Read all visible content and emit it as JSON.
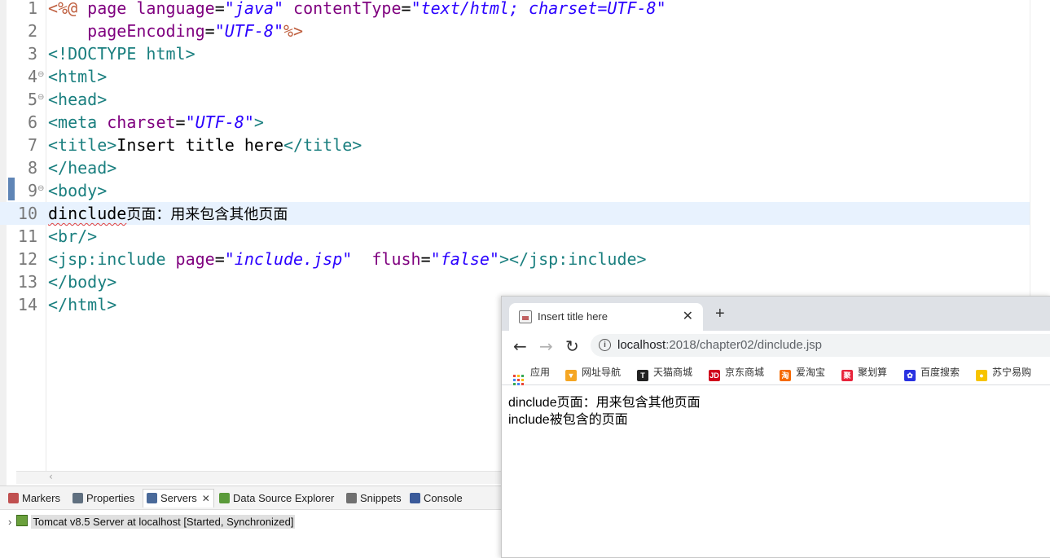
{
  "editor": {
    "lines": [
      {
        "n": "1",
        "tokens": [
          {
            "t": "<%@ ",
            "c": "dir"
          },
          {
            "t": "page ",
            "c": "attr"
          },
          {
            "t": "language",
            "c": "attr"
          },
          {
            "t": "=",
            "c": "plain"
          },
          {
            "t": "\"java\"",
            "c": "val"
          },
          {
            "t": " contentType",
            "c": "attr"
          },
          {
            "t": "=",
            "c": "plain"
          },
          {
            "t": "\"text/html; charset=UTF-8\"",
            "c": "val"
          }
        ]
      },
      {
        "n": "2",
        "tokens": [
          {
            "t": "    pageEncoding",
            "c": "attr"
          },
          {
            "t": "=",
            "c": "plain"
          },
          {
            "t": "\"UTF-8\"",
            "c": "val"
          },
          {
            "t": "%>",
            "c": "dir"
          }
        ]
      },
      {
        "n": "3",
        "tokens": [
          {
            "t": "<!DOCTYPE ",
            "c": "tag"
          },
          {
            "t": "html",
            "c": "tag"
          },
          {
            "t": ">",
            "c": "tag"
          }
        ]
      },
      {
        "n": "4",
        "fold": true,
        "tokens": [
          {
            "t": "<html>",
            "c": "tag"
          }
        ]
      },
      {
        "n": "5",
        "fold": true,
        "tokens": [
          {
            "t": "<head>",
            "c": "tag"
          }
        ]
      },
      {
        "n": "6",
        "tokens": [
          {
            "t": "<meta ",
            "c": "tag"
          },
          {
            "t": "charset",
            "c": "attr"
          },
          {
            "t": "=",
            "c": "plain"
          },
          {
            "t": "\"UTF-8\"",
            "c": "val"
          },
          {
            "t": ">",
            "c": "tag"
          }
        ]
      },
      {
        "n": "7",
        "tokens": [
          {
            "t": "<title>",
            "c": "tag"
          },
          {
            "t": "Insert title here",
            "c": "plain"
          },
          {
            "t": "</title>",
            "c": "tag"
          }
        ]
      },
      {
        "n": "8",
        "tokens": [
          {
            "t": "</head>",
            "c": "tag"
          }
        ]
      },
      {
        "n": "9",
        "fold": true,
        "tokens": [
          {
            "t": "<body>",
            "c": "tag"
          }
        ]
      },
      {
        "n": "10",
        "current": true,
        "tokens": [
          {
            "t": "dinclude",
            "c": "plain squiggle"
          },
          {
            "t": "页面：用来包含其他页面",
            "c": "cjk"
          }
        ]
      },
      {
        "n": "11",
        "tokens": [
          {
            "t": "<br/>",
            "c": "tag"
          }
        ]
      },
      {
        "n": "12",
        "tokens": [
          {
            "t": "<jsp:include ",
            "c": "tag"
          },
          {
            "t": "page",
            "c": "attr"
          },
          {
            "t": "=",
            "c": "plain"
          },
          {
            "t": "\"include.jsp\"",
            "c": "val"
          },
          {
            "t": "  flush",
            "c": "attr"
          },
          {
            "t": "=",
            "c": "plain"
          },
          {
            "t": "\"false\"",
            "c": "val"
          },
          {
            "t": "></jsp:include>",
            "c": "tag"
          }
        ]
      },
      {
        "n": "13",
        "tokens": [
          {
            "t": "</body>",
            "c": "tag"
          }
        ]
      },
      {
        "n": "14",
        "tokens": [
          {
            "t": "</html>",
            "c": "tag"
          }
        ]
      }
    ]
  },
  "panel": {
    "tabs": [
      {
        "label": "Markers",
        "icon": "markers-icon",
        "color": "#c05050"
      },
      {
        "label": "Properties",
        "icon": "properties-icon",
        "color": "#607080"
      },
      {
        "label": "Servers",
        "icon": "servers-icon",
        "color": "#4a6a9a",
        "active": true
      },
      {
        "label": "Data Source Explorer",
        "icon": "data-source-icon",
        "color": "#5a9a3a"
      },
      {
        "label": "Snippets",
        "icon": "snippets-icon",
        "color": "#707070"
      },
      {
        "label": "Console",
        "icon": "console-icon",
        "color": "#3a5a9a"
      }
    ],
    "server_entry": "Tomcat v8.5 Server at localhost  [Started, Synchronized]"
  },
  "browser": {
    "tab_title": "Insert title here",
    "url_host": "localhost",
    "url_rest": ":2018/chapter02/dinclude.jsp",
    "bookmarks": [
      {
        "label": "应用",
        "icon": "apps-grid-icon"
      },
      {
        "label": "网址导航",
        "icon": "hao-nav-icon",
        "color": "#f5a623",
        "glyph": "▼"
      },
      {
        "label": "天猫商城",
        "icon": "tmall-icon",
        "color": "#222222",
        "glyph": "T"
      },
      {
        "label": "京东商城",
        "icon": "jd-icon",
        "color": "#d0021b",
        "glyph": "JD"
      },
      {
        "label": "爱淘宝",
        "icon": "aitaobao-icon",
        "color": "#f56a00",
        "glyph": "淘"
      },
      {
        "label": "聚划算",
        "icon": "juhuasuan-icon",
        "color": "#e8243c",
        "glyph": "聚"
      },
      {
        "label": "百度搜索",
        "icon": "baidu-icon",
        "color": "#2932e1",
        "glyph": "✿"
      },
      {
        "label": "苏宁易购",
        "icon": "suning-icon",
        "color": "#f7c400",
        "glyph": "●"
      }
    ],
    "content_lines": [
      "dinclude页面：用来包含其他页面",
      "include被包含的页面"
    ]
  }
}
